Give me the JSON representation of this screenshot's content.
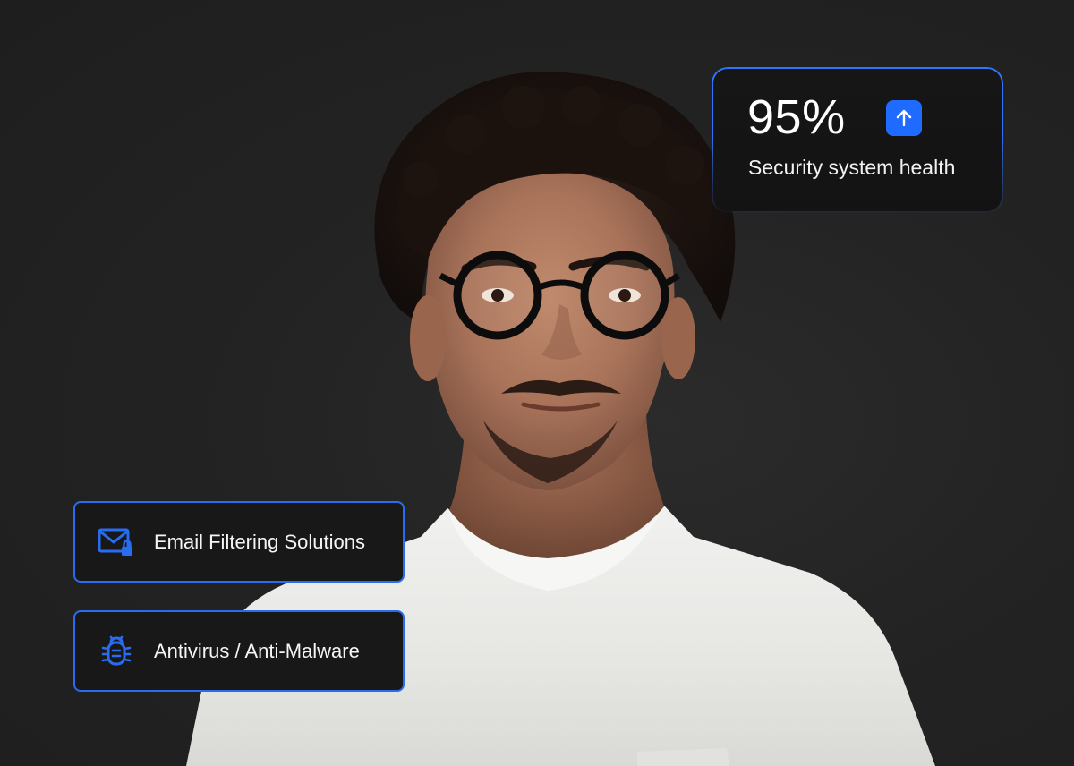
{
  "colors": {
    "background": "#202020",
    "accent_blue": "#1f6bff",
    "card_background": "#181818",
    "text": "#ffffff"
  },
  "stat_card": {
    "value": "95%",
    "label": "Security system health",
    "trend_icon": "arrow-up-icon"
  },
  "features": [
    {
      "label": "Email Filtering Solutions",
      "icon": "email-lock-icon"
    },
    {
      "label": "Antivirus / Anti-Malware",
      "icon": "bug-icon"
    }
  ]
}
